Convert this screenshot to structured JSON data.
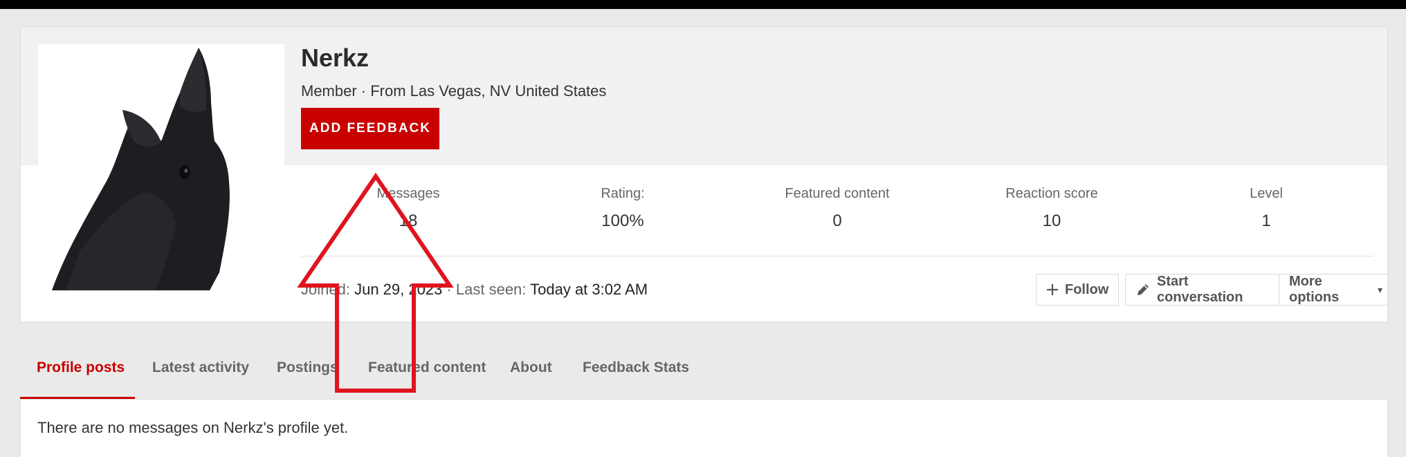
{
  "profile": {
    "username": "Nerkz",
    "meta": "Member · From Las Vegas, NV United States",
    "feedback_button": "ADD FEEDBACK",
    "avatar_icon": "raven-avatar"
  },
  "stats": [
    {
      "label": "Messages",
      "value": "18"
    },
    {
      "label": "Rating:",
      "value": "100%"
    },
    {
      "label": "Featured content",
      "value": "0"
    },
    {
      "label": "Reaction score",
      "value": "10"
    },
    {
      "label": "Level",
      "value": "1"
    }
  ],
  "activity": {
    "joined_label": "Joined:",
    "joined_value": "Jun 29, 2023",
    "separator": "·",
    "last_seen_label": "Last seen:",
    "last_seen_value": "Today at 3:02 AM"
  },
  "actions": {
    "follow": "Follow",
    "start_conversation": "Start conversation",
    "more_options": "More options"
  },
  "tabs": [
    {
      "label": "Profile posts",
      "active": true
    },
    {
      "label": "Latest activity",
      "active": false
    },
    {
      "label": "Postings",
      "active": false
    },
    {
      "label": "Featured content",
      "active": false
    },
    {
      "label": "About",
      "active": false
    },
    {
      "label": "Feedback Stats",
      "active": false
    }
  ],
  "content": {
    "empty_message": "There are no messages on Nerkz's profile yet."
  },
  "colors": {
    "accent": "#c80000",
    "annotation": "#e0141e"
  }
}
